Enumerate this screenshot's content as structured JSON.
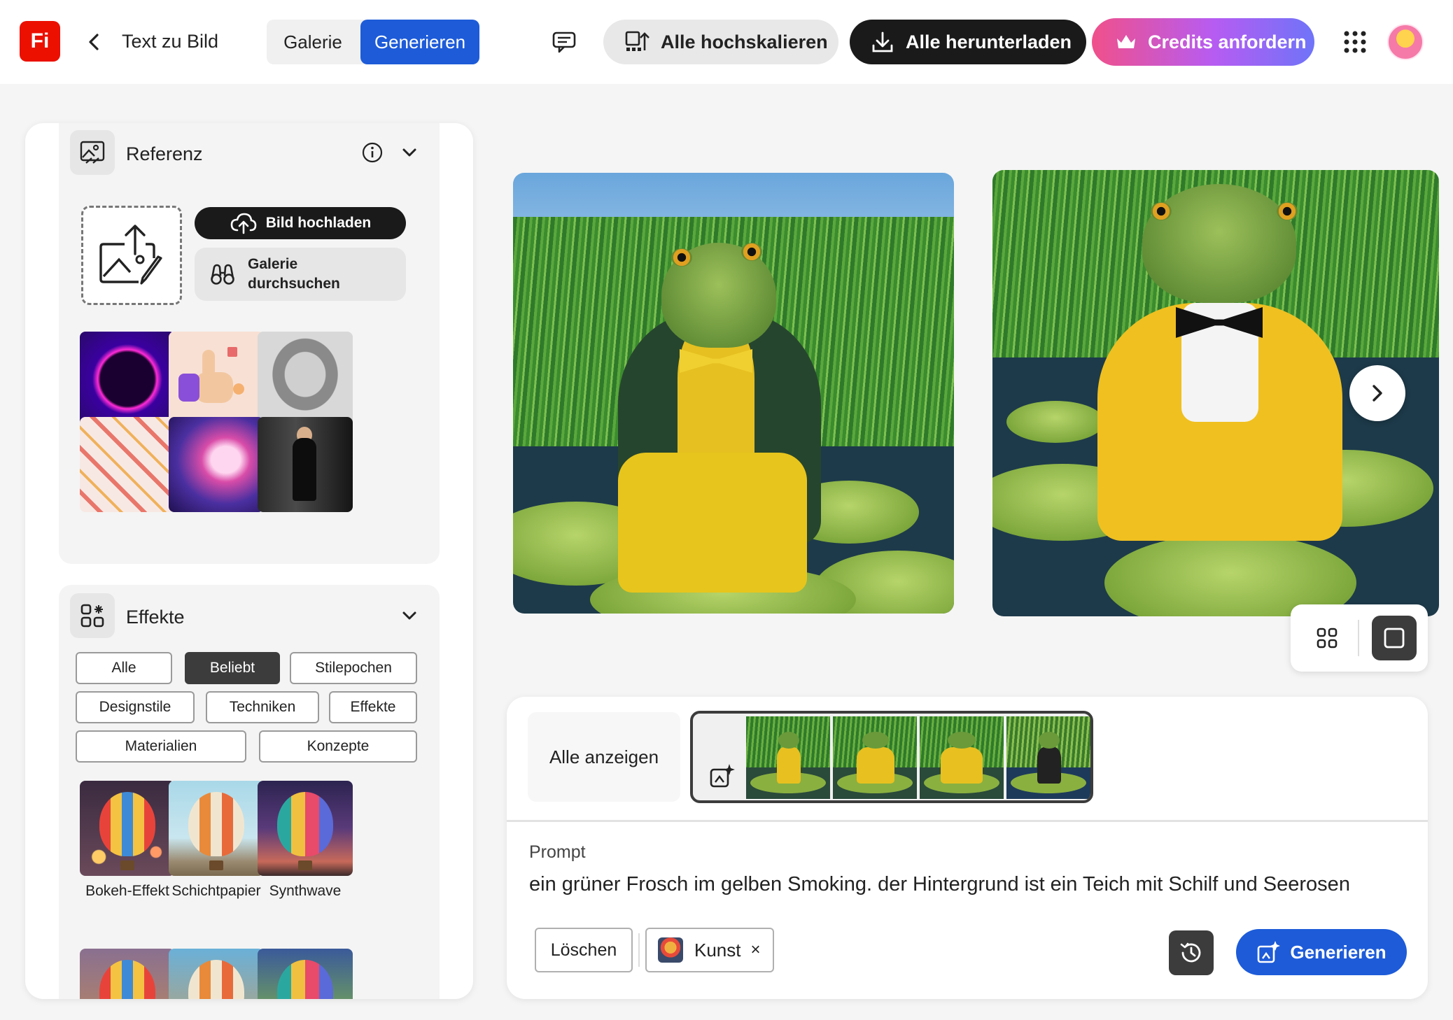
{
  "header": {
    "logo_text": "Fi",
    "title": "Text zu Bild",
    "tabs": [
      {
        "label": "Galerie",
        "active": false
      },
      {
        "label": "Generieren",
        "active": true
      }
    ],
    "upscale_all_label": "Alle hochskalieren",
    "download_all_label": "Alle herunterladen",
    "credits_label": "Credits anfordern",
    "colors": {
      "accent": "#1d5bd8",
      "logo": "#eb1000",
      "credits_from": "#f0508a",
      "credits_to": "#6f74f8"
    }
  },
  "reference": {
    "title": "Referenz",
    "upload_label": "Bild hochladen",
    "browse_label_line1": "Galerie",
    "browse_label_line2": "durchsuchen"
  },
  "effects": {
    "title": "Effekte",
    "filters": [
      {
        "label": "Alle",
        "active": false
      },
      {
        "label": "Beliebt",
        "active": true
      },
      {
        "label": "Stilepochen",
        "active": false
      },
      {
        "label": "Designstile",
        "active": false
      },
      {
        "label": "Techniken",
        "active": false
      },
      {
        "label": "Effekte",
        "active": false
      },
      {
        "label": "Materialien",
        "active": false
      },
      {
        "label": "Konzepte",
        "active": false
      }
    ],
    "items": [
      {
        "label": "Bokeh-Effekt"
      },
      {
        "label": "Schichtpapier"
      },
      {
        "label": "Synthwave"
      }
    ]
  },
  "results": {
    "view_modes": [
      "grid-view-icon",
      "single-view-icon"
    ],
    "active_view": "single"
  },
  "prompt_panel": {
    "show_all_label": "Alle anzeigen",
    "prompt_label": "Prompt",
    "prompt_text": "ein grüner Frosch im gelben Smoking. der Hintergrund ist ein Teich mit Schilf und Seerosen",
    "clear_label": "Löschen",
    "style_tag": "Kunst",
    "tag_remove": "×",
    "generate_label": "Generieren"
  }
}
